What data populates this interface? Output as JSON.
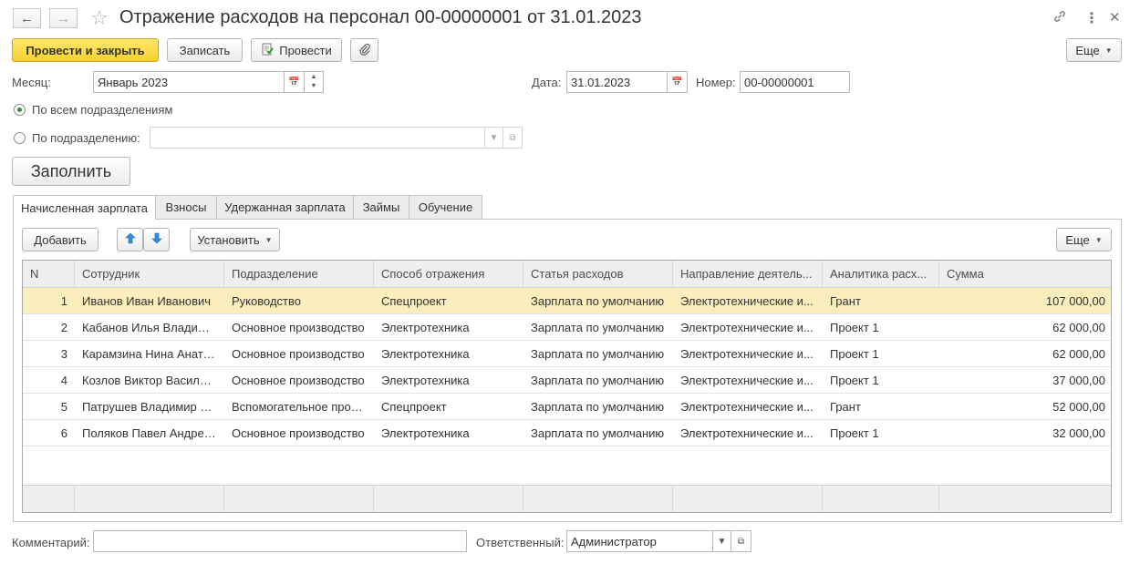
{
  "window": {
    "title": "Отражение расходов на персонал 00-00000001 от 31.01.2023"
  },
  "icons": {
    "back": "arrow-left-icon",
    "forward": "arrow-right-icon",
    "favorite": "star-icon",
    "link": "link-icon",
    "menu": "more-vertical-icon",
    "close": "close-icon"
  },
  "toolbar": {
    "post_close_label": "Провести и закрыть",
    "save_label": "Записать",
    "post_label": "Провести",
    "more_label": "Еще"
  },
  "form": {
    "month_label": "Месяц:",
    "month_value": "Январь 2023",
    "date_label": "Дата:",
    "date_value": "31.01.2023",
    "number_label": "Номер:",
    "number_value": "00-00000001",
    "radio_all_label": "По всем подразделениям",
    "radio_dept_label": "По подразделению:",
    "dept_value": "",
    "fill_label": "Заполнить"
  },
  "tabs": [
    {
      "label": "Начисленная зарплата"
    },
    {
      "label": "Взносы"
    },
    {
      "label": "Удержанная зарплата"
    },
    {
      "label": "Займы"
    },
    {
      "label": "Обучение"
    }
  ],
  "table_toolbar": {
    "add_label": "Добавить",
    "set_label": "Установить",
    "more_label": "Еще"
  },
  "table": {
    "columns": [
      "N",
      "Сотрудник",
      "Подразделение",
      "Способ отражения",
      "Статья расходов",
      "Направление деятель...",
      "Аналитика расх...",
      "Сумма"
    ],
    "rows": [
      [
        "1",
        "Иванов Иван Иванович",
        "Руководство",
        "Спецпроект",
        "Зарплата по умолчанию",
        "Электротехнические и...",
        "Грант",
        "107 000,00"
      ],
      [
        "2",
        "Кабанов Илья Владимирович",
        "Основное производство",
        "Электротехника",
        "Зарплата по умолчанию",
        "Электротехнические и...",
        "Проект 1",
        "62 000,00"
      ],
      [
        "3",
        "Карамзина Нина Анатольевна",
        "Основное производство",
        "Электротехника",
        "Зарплата по умолчанию",
        "Электротехнические и...",
        "Проект 1",
        "62 000,00"
      ],
      [
        "4",
        "Козлов Виктор Васильевич",
        "Основное производство",
        "Электротехника",
        "Зарплата по умолчанию",
        "Электротехнические и...",
        "Проект 1",
        "37 000,00"
      ],
      [
        "5",
        "Патрушев Владимир Петрович",
        "Вспомогательное производство",
        "Спецпроект",
        "Зарплата по умолчанию",
        "Электротехнические и...",
        "Грант",
        "52 000,00"
      ],
      [
        "6",
        "Поляков Павел Андреевич",
        "Основное производство",
        "Электротехника",
        "Зарплата по умолчанию",
        "Электротехнические и...",
        "Проект 1",
        "32 000,00"
      ]
    ],
    "selected_row": 0
  },
  "footer": {
    "comment_label": "Комментарий:",
    "comment_value": "",
    "responsible_label": "Ответственный:",
    "responsible_value": "Администратор"
  },
  "colors": {
    "primary_button": "#f7d12e",
    "selected_row": "#fbeebd",
    "arrow_blue": "#2f8fd8"
  }
}
